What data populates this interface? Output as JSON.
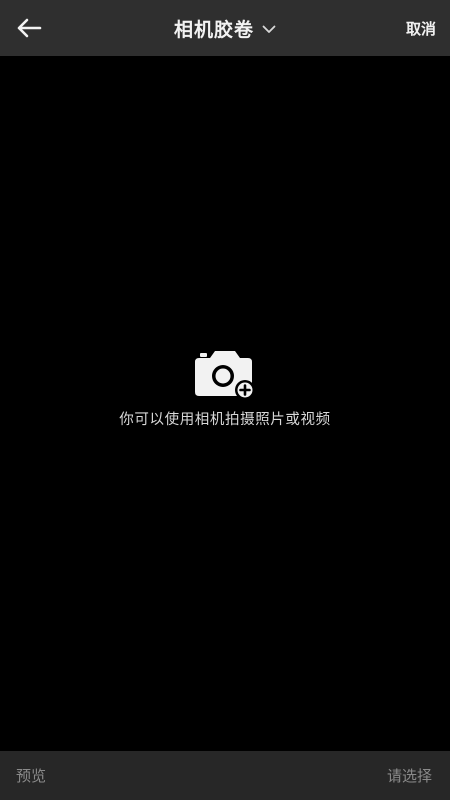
{
  "header": {
    "back_icon": "arrow-left-icon",
    "title": "相机胶卷",
    "title_dropdown_icon": "chevron-down-icon",
    "cancel_label": "取消"
  },
  "empty_state": {
    "icon": "camera-add-icon",
    "message": "你可以使用相机拍摄照片或视频"
  },
  "footer": {
    "preview_label": "预览",
    "select_label": "请选择"
  },
  "colors": {
    "header_bg": "#2f2f2f",
    "footer_bg": "#272727",
    "content_bg": "#000000",
    "primary_text": "#f2f2f2",
    "muted_text": "#8a8a8a"
  }
}
